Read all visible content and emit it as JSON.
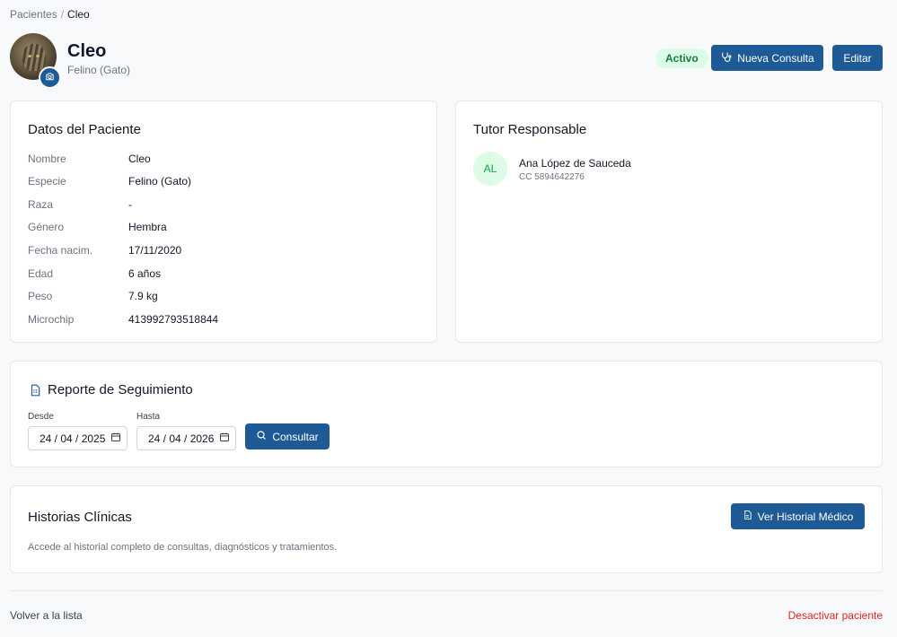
{
  "breadcrumb": {
    "parent": "Pacientes",
    "separator": "/",
    "current": "Cleo"
  },
  "patient": {
    "name": "Cleo",
    "species": "Felino (Gato)",
    "status": "Activo"
  },
  "actions": {
    "new_consult": "Nueva Consulta",
    "edit": "Editar"
  },
  "datos": {
    "title": "Datos del Paciente",
    "rows": [
      {
        "label": "Nombre",
        "value": "Cleo"
      },
      {
        "label": "Especie",
        "value": "Felino (Gato)"
      },
      {
        "label": "Raza",
        "value": "-"
      },
      {
        "label": "Género",
        "value": "Hembra"
      },
      {
        "label": "Fecha nacim.",
        "value": "17/11/2020"
      },
      {
        "label": "Edad",
        "value": "6 años"
      },
      {
        "label": "Peso",
        "value": "7.9 kg"
      },
      {
        "label": "Microchip",
        "value": "413992793518844"
      }
    ]
  },
  "tutor": {
    "title": "Tutor Responsable",
    "initials": "AL",
    "name": "Ana López de Sauceda",
    "document": "CC 5894642276"
  },
  "reporte": {
    "title": "Reporte de Seguimiento",
    "from_label": "Desde",
    "from_value": "24 / 04 / 2025",
    "to_label": "Hasta",
    "to_value": "24 / 04 / 2026",
    "button": "Consultar"
  },
  "historias": {
    "title": "Historias Clínicas",
    "description": "Accede al historial completo de consultas, diagnósticos y tratamientos.",
    "button": "Ver Historial Médico"
  },
  "footer": {
    "back": "Volver a la lista",
    "deactivate": "Desactivar paciente"
  },
  "colors": {
    "primary": "#1e5a96",
    "success_bg": "#dcfce7",
    "success_text": "#15803d",
    "danger": "#dc2626"
  },
  "icons": [
    "camera-icon",
    "stethoscope-icon",
    "document-icon",
    "search-icon",
    "calendar-icon",
    "file-icon"
  ]
}
